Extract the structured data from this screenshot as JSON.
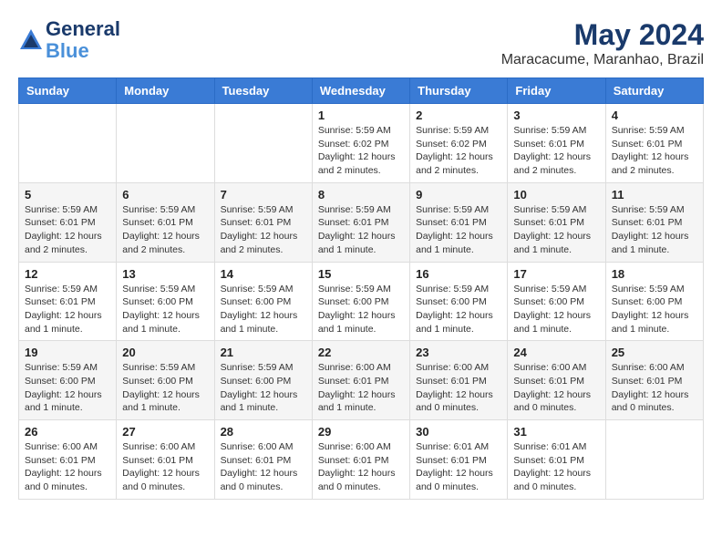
{
  "header": {
    "logo_line1": "General",
    "logo_line2": "Blue",
    "month": "May 2024",
    "location": "Maracacume, Maranhao, Brazil"
  },
  "days_of_week": [
    "Sunday",
    "Monday",
    "Tuesday",
    "Wednesday",
    "Thursday",
    "Friday",
    "Saturday"
  ],
  "weeks": [
    [
      {
        "day": "",
        "info": ""
      },
      {
        "day": "",
        "info": ""
      },
      {
        "day": "",
        "info": ""
      },
      {
        "day": "1",
        "info": "Sunrise: 5:59 AM\nSunset: 6:02 PM\nDaylight: 12 hours\nand 2 minutes."
      },
      {
        "day": "2",
        "info": "Sunrise: 5:59 AM\nSunset: 6:02 PM\nDaylight: 12 hours\nand 2 minutes."
      },
      {
        "day": "3",
        "info": "Sunrise: 5:59 AM\nSunset: 6:01 PM\nDaylight: 12 hours\nand 2 minutes."
      },
      {
        "day": "4",
        "info": "Sunrise: 5:59 AM\nSunset: 6:01 PM\nDaylight: 12 hours\nand 2 minutes."
      }
    ],
    [
      {
        "day": "5",
        "info": "Sunrise: 5:59 AM\nSunset: 6:01 PM\nDaylight: 12 hours\nand 2 minutes."
      },
      {
        "day": "6",
        "info": "Sunrise: 5:59 AM\nSunset: 6:01 PM\nDaylight: 12 hours\nand 2 minutes."
      },
      {
        "day": "7",
        "info": "Sunrise: 5:59 AM\nSunset: 6:01 PM\nDaylight: 12 hours\nand 2 minutes."
      },
      {
        "day": "8",
        "info": "Sunrise: 5:59 AM\nSunset: 6:01 PM\nDaylight: 12 hours\nand 1 minute."
      },
      {
        "day": "9",
        "info": "Sunrise: 5:59 AM\nSunset: 6:01 PM\nDaylight: 12 hours\nand 1 minute."
      },
      {
        "day": "10",
        "info": "Sunrise: 5:59 AM\nSunset: 6:01 PM\nDaylight: 12 hours\nand 1 minute."
      },
      {
        "day": "11",
        "info": "Sunrise: 5:59 AM\nSunset: 6:01 PM\nDaylight: 12 hours\nand 1 minute."
      }
    ],
    [
      {
        "day": "12",
        "info": "Sunrise: 5:59 AM\nSunset: 6:01 PM\nDaylight: 12 hours\nand 1 minute."
      },
      {
        "day": "13",
        "info": "Sunrise: 5:59 AM\nSunset: 6:00 PM\nDaylight: 12 hours\nand 1 minute."
      },
      {
        "day": "14",
        "info": "Sunrise: 5:59 AM\nSunset: 6:00 PM\nDaylight: 12 hours\nand 1 minute."
      },
      {
        "day": "15",
        "info": "Sunrise: 5:59 AM\nSunset: 6:00 PM\nDaylight: 12 hours\nand 1 minute."
      },
      {
        "day": "16",
        "info": "Sunrise: 5:59 AM\nSunset: 6:00 PM\nDaylight: 12 hours\nand 1 minute."
      },
      {
        "day": "17",
        "info": "Sunrise: 5:59 AM\nSunset: 6:00 PM\nDaylight: 12 hours\nand 1 minute."
      },
      {
        "day": "18",
        "info": "Sunrise: 5:59 AM\nSunset: 6:00 PM\nDaylight: 12 hours\nand 1 minute."
      }
    ],
    [
      {
        "day": "19",
        "info": "Sunrise: 5:59 AM\nSunset: 6:00 PM\nDaylight: 12 hours\nand 1 minute."
      },
      {
        "day": "20",
        "info": "Sunrise: 5:59 AM\nSunset: 6:00 PM\nDaylight: 12 hours\nand 1 minute."
      },
      {
        "day": "21",
        "info": "Sunrise: 5:59 AM\nSunset: 6:00 PM\nDaylight: 12 hours\nand 1 minute."
      },
      {
        "day": "22",
        "info": "Sunrise: 6:00 AM\nSunset: 6:01 PM\nDaylight: 12 hours\nand 1 minute."
      },
      {
        "day": "23",
        "info": "Sunrise: 6:00 AM\nSunset: 6:01 PM\nDaylight: 12 hours\nand 0 minutes."
      },
      {
        "day": "24",
        "info": "Sunrise: 6:00 AM\nSunset: 6:01 PM\nDaylight: 12 hours\nand 0 minutes."
      },
      {
        "day": "25",
        "info": "Sunrise: 6:00 AM\nSunset: 6:01 PM\nDaylight: 12 hours\nand 0 minutes."
      }
    ],
    [
      {
        "day": "26",
        "info": "Sunrise: 6:00 AM\nSunset: 6:01 PM\nDaylight: 12 hours\nand 0 minutes."
      },
      {
        "day": "27",
        "info": "Sunrise: 6:00 AM\nSunset: 6:01 PM\nDaylight: 12 hours\nand 0 minutes."
      },
      {
        "day": "28",
        "info": "Sunrise: 6:00 AM\nSunset: 6:01 PM\nDaylight: 12 hours\nand 0 minutes."
      },
      {
        "day": "29",
        "info": "Sunrise: 6:00 AM\nSunset: 6:01 PM\nDaylight: 12 hours\nand 0 minutes."
      },
      {
        "day": "30",
        "info": "Sunrise: 6:01 AM\nSunset: 6:01 PM\nDaylight: 12 hours\nand 0 minutes."
      },
      {
        "day": "31",
        "info": "Sunrise: 6:01 AM\nSunset: 6:01 PM\nDaylight: 12 hours\nand 0 minutes."
      },
      {
        "day": "",
        "info": ""
      }
    ]
  ]
}
